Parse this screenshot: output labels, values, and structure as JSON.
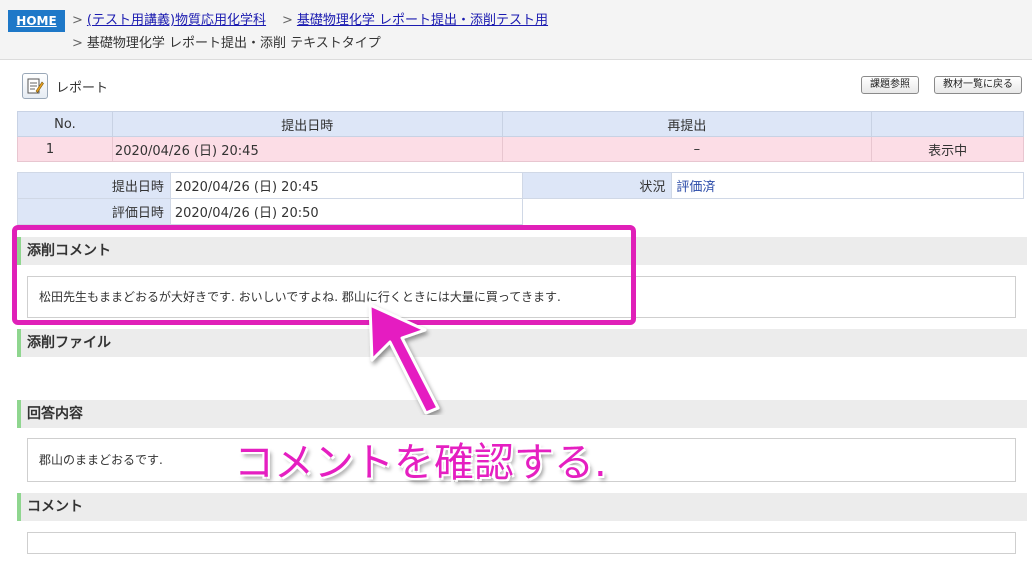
{
  "breadcrumb": {
    "home": "HOME",
    "course": "(テスト用講義)物質応用化学科",
    "assignment": "基礎物理化学 レポート提出・添削テスト用",
    "current": "基礎物理化学 レポート提出・添削 テキストタイプ",
    "separator": ">"
  },
  "header": {
    "icon": "report-icon",
    "title": "レポート",
    "buttons": [
      "課題参照",
      "教材一覧に戻る"
    ]
  },
  "submissions": {
    "headers": [
      "No.",
      "提出日時",
      "再提出",
      ""
    ],
    "rows": [
      {
        "no": "1",
        "date": "2020/04/26 (日) 20:45",
        "resubmit": "–",
        "status": "表示中"
      }
    ]
  },
  "detail": {
    "submitted_label": "提出日時",
    "submitted_value": "2020/04/26 (日) 20:45",
    "status_label": "状況",
    "status_value": "評価済",
    "evaluated_label": "評価日時",
    "evaluated_value": "2020/04/26 (日) 20:50"
  },
  "sections": {
    "correction_comment": {
      "title": "添削コメント",
      "text": "松田先生もままどおるが大好きです. おいしいですよね. 郡山に行くときには大量に買ってきます."
    },
    "correction_file": {
      "title": "添削ファイル"
    },
    "answer": {
      "title": "回答内容",
      "text": "郡山のままどおるです."
    },
    "comment": {
      "title": "コメント",
      "text": ""
    }
  },
  "annotation": {
    "callout": "コメントを確認する."
  },
  "colors": {
    "home": "#1e78c8",
    "link": "#1a1ab0",
    "table_header": "#dde6f7",
    "row_highlight": "#fcdde6",
    "section_accent": "#8fd68f",
    "annotation": "#e020b8"
  }
}
